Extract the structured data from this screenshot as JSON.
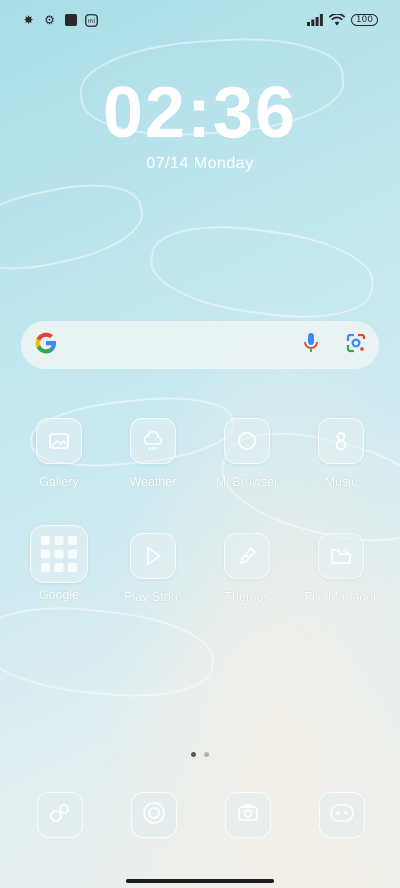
{
  "status": {
    "battery": "100"
  },
  "lockscreen": {
    "time": "02:36",
    "date": "07/14  Monday"
  },
  "search": {
    "logo": "G"
  },
  "apps": [
    {
      "label": "Gallery",
      "icon": "gallery-icon"
    },
    {
      "label": "Weather",
      "icon": "weather-icon"
    },
    {
      "label": "Mi Browser",
      "icon": "browser-icon"
    },
    {
      "label": "Music",
      "icon": "music-icon"
    },
    {
      "label": "Google",
      "icon": "google-folder-icon"
    },
    {
      "label": "Play Store",
      "icon": "play-store-icon"
    },
    {
      "label": "Themes",
      "icon": "themes-icon"
    },
    {
      "label": "File Manager",
      "icon": "file-manager-icon"
    }
  ],
  "dock": [
    {
      "icon": "phone-icon"
    },
    {
      "icon": "messages-icon"
    },
    {
      "icon": "camera-icon"
    },
    {
      "icon": "chat-icon"
    }
  ],
  "page_indicator": {
    "pages": 2,
    "current": 1
  },
  "colors": {
    "text": "#ffffff",
    "status": "#2a2a2a",
    "search_bg": "#f0f4f5"
  }
}
